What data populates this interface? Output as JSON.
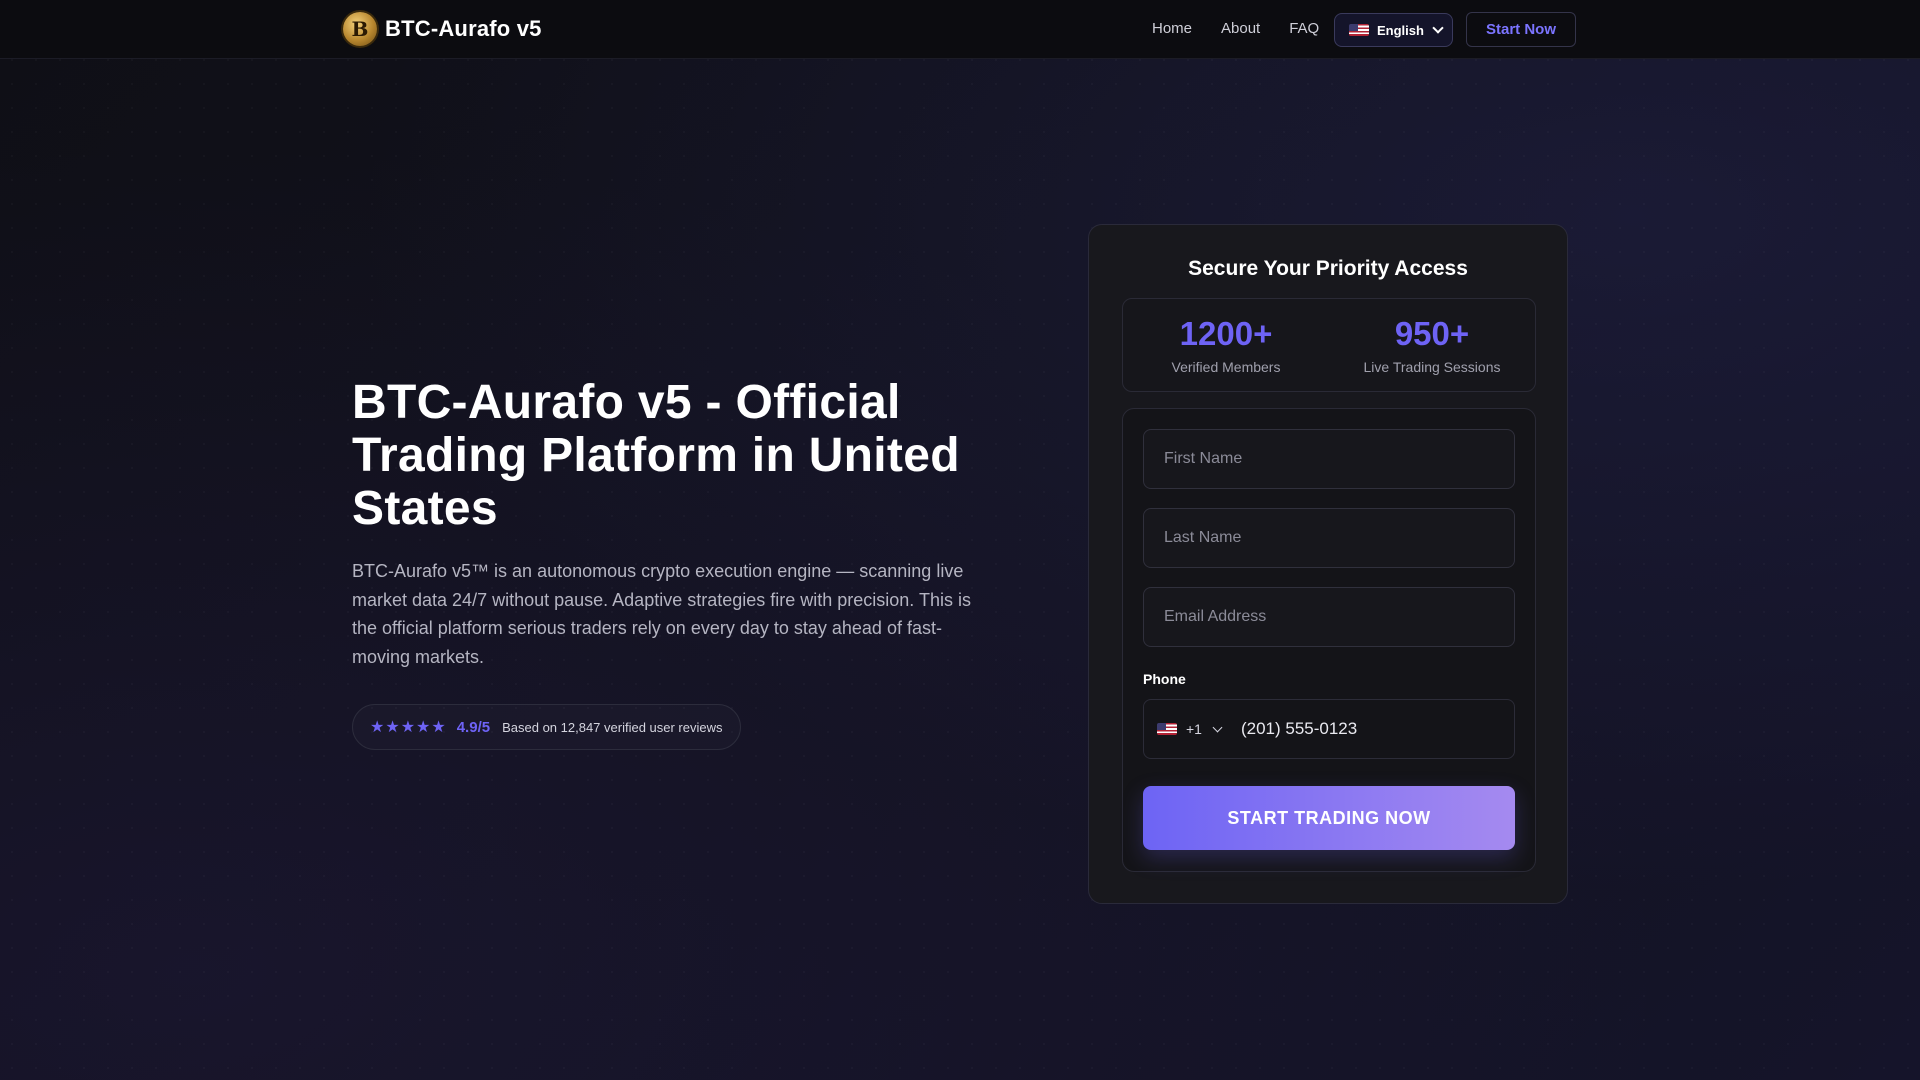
{
  "nav": {
    "brand": "BTC-Aurafo v5",
    "logo_letter": "B",
    "links": [
      "Home",
      "About",
      "FAQ"
    ],
    "language": "English",
    "language_icon": "us-flag-icon",
    "cta": "Start Now"
  },
  "hero": {
    "title": "BTC-Aurafo v5 - Official Trading Platform in United States",
    "description": "BTC-Aurafo v5™ is an autonomous crypto execution engine — scanning live market data 24/7 without pause. Adaptive strategies fire with precision. This is the official platform serious traders rely on every day to stay ahead of fast-moving markets.",
    "rating": {
      "stars": "★★★★★",
      "score": "4.9/5",
      "reviews": "Based on 12,847 verified user reviews"
    }
  },
  "form": {
    "title": "Secure Your Priority Access",
    "stats": [
      {
        "value": "1200+",
        "label": "Verified Members"
      },
      {
        "value": "950+",
        "label": "Live Trading Sessions"
      }
    ],
    "first_name_placeholder": "First Name",
    "last_name_placeholder": "Last Name",
    "email_placeholder": "Email Address",
    "phone_label": "Phone",
    "country_code": "+1",
    "phone_placeholder": "(201) 555-0123",
    "submit": "START TRADING NOW"
  },
  "colors": {
    "accent": "#6e63f5",
    "button_gradient_start": "#6d64f4",
    "button_gradient_end": "#a58af0",
    "background": "#12121e"
  }
}
